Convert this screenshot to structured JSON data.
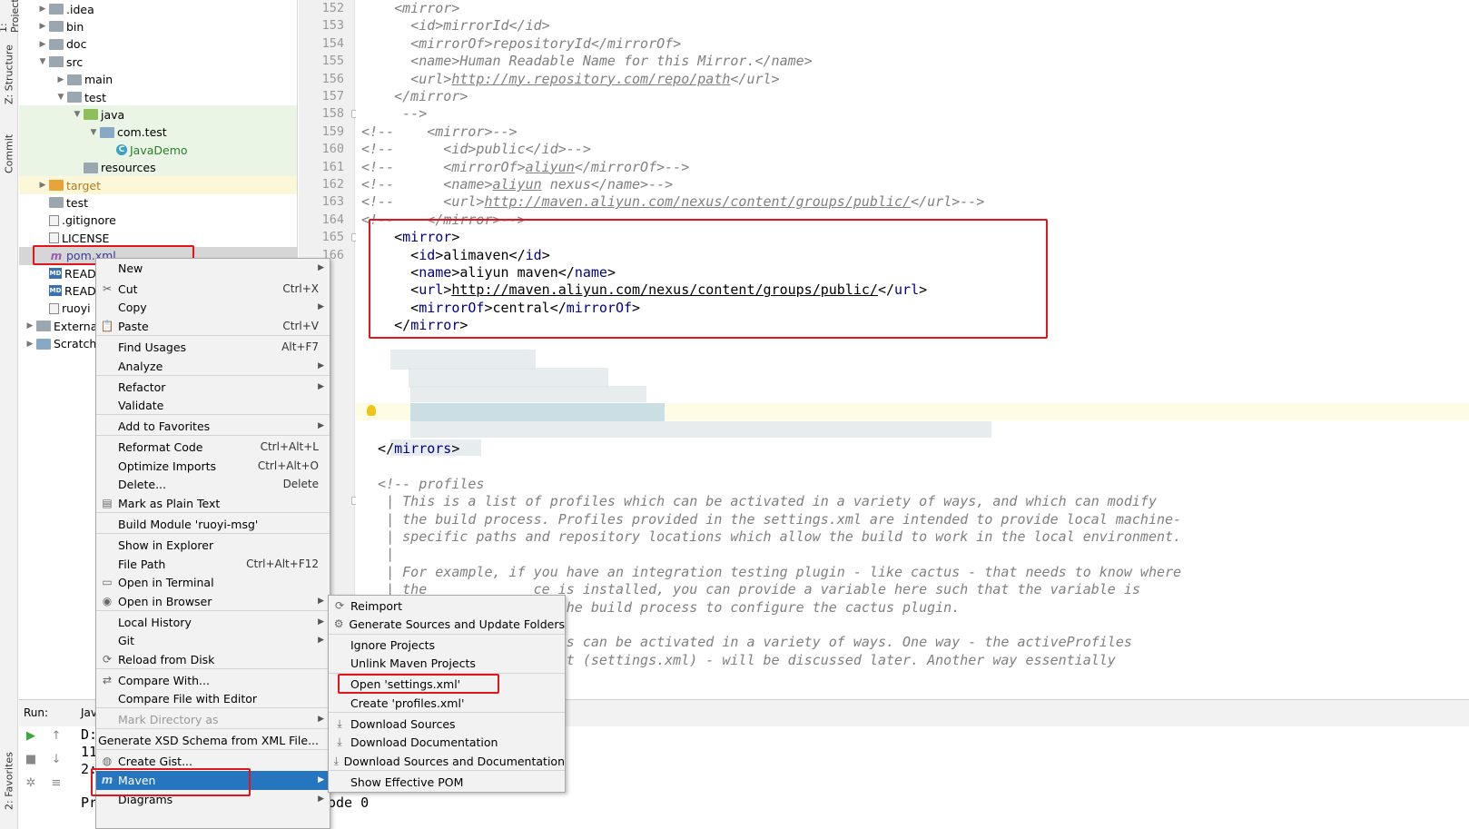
{
  "stripe": {
    "tabs": [
      {
        "label": "1: Project"
      },
      {
        "label": "Z: Structure"
      },
      {
        "label": "Commit"
      },
      {
        "label": "2: Favorites"
      }
    ]
  },
  "tree": {
    "items": [
      {
        "label": ".idea",
        "type": "folder"
      },
      {
        "label": "bin",
        "type": "folder"
      },
      {
        "label": "doc",
        "type": "folder"
      },
      {
        "label": "src",
        "type": "folder"
      },
      {
        "label": "main",
        "type": "folder"
      },
      {
        "label": "test",
        "type": "folder"
      },
      {
        "label": "java",
        "type": "folder-green"
      },
      {
        "label": "com.test",
        "type": "package"
      },
      {
        "label": "JavaDemo",
        "type": "class"
      },
      {
        "label": "resources",
        "type": "resources"
      },
      {
        "label": "target",
        "type": "folder-orange"
      },
      {
        "label": "test",
        "type": "folder"
      },
      {
        "label": ".gitignore",
        "type": "file"
      },
      {
        "label": "LICENSE",
        "type": "file"
      },
      {
        "label": "pom.xml",
        "type": "maven"
      },
      {
        "label": "READ",
        "type": "md"
      },
      {
        "label": "READ",
        "type": "md"
      },
      {
        "label": "ruoyi",
        "type": "file"
      },
      {
        "label": "External",
        "type": "lib"
      },
      {
        "label": "Scratche",
        "type": "scratch"
      }
    ]
  },
  "editor": {
    "line_numbers": [
      "152",
      "153",
      "154",
      "155",
      "156",
      "157",
      "158",
      "159",
      "160",
      "161",
      "162",
      "163",
      "164",
      "165",
      "166"
    ],
    "lines": [
      {
        "parts": [
          {
            "t": "    <mirror>",
            "c": "cm"
          }
        ]
      },
      {
        "parts": [
          {
            "t": "      <id>mirrorId</id>",
            "c": "cm"
          }
        ]
      },
      {
        "parts": [
          {
            "t": "      <mirrorOf>repositoryId</mirrorOf>",
            "c": "cm"
          }
        ]
      },
      {
        "parts": [
          {
            "t": "      <name>Human Readable Name for this Mirror.</name>",
            "c": "cm"
          }
        ]
      },
      {
        "parts": [
          {
            "t": "      <url>",
            "c": "cm"
          },
          {
            "t": "http://my.repository.com/repo/path",
            "c": "cm url"
          },
          {
            "t": "</url>",
            "c": "cm"
          }
        ]
      },
      {
        "parts": [
          {
            "t": "    </mirror>",
            "c": "cm"
          }
        ]
      },
      {
        "parts": [
          {
            "t": "     -->",
            "c": "cm"
          }
        ]
      },
      {
        "parts": [
          {
            "t": "<!--    <mirror>-->",
            "c": "cm"
          }
        ]
      },
      {
        "parts": [
          {
            "t": "<!--      <id>public</id>-->",
            "c": "cm"
          }
        ]
      },
      {
        "parts": [
          {
            "t": "<!--      <mirrorOf>",
            "c": "cm"
          },
          {
            "t": "aliyun",
            "c": "cm url"
          },
          {
            "t": "</mirrorOf>-->",
            "c": "cm"
          }
        ]
      },
      {
        "parts": [
          {
            "t": "<!--      <name>",
            "c": "cm"
          },
          {
            "t": "aliyun",
            "c": "cm url"
          },
          {
            "t": " nexus</name>-->",
            "c": "cm"
          }
        ]
      },
      {
        "parts": [
          {
            "t": "<!--      <url>",
            "c": "cm"
          },
          {
            "t": "http://maven.aliyun.com/nexus/content/groups/public/",
            "c": "cm url"
          },
          {
            "t": "</url>-->",
            "c": "cm"
          }
        ]
      },
      {
        "parts": [
          {
            "t": "<!--    </mirror>-->",
            "c": "cm"
          }
        ]
      },
      {
        "parts": [
          {
            "t": "    <",
            "c": "at"
          },
          {
            "t": "mirror",
            "c": "tg"
          },
          {
            "t": ">",
            "c": "at"
          }
        ]
      },
      {
        "parts": [
          {
            "t": "      <",
            "c": "at"
          },
          {
            "t": "id",
            "c": "tg"
          },
          {
            "t": ">alimaven</",
            "c": "at"
          },
          {
            "t": "id",
            "c": "tg"
          },
          {
            "t": ">",
            "c": "at"
          }
        ]
      },
      {
        "parts": [
          {
            "t": "      <",
            "c": "at"
          },
          {
            "t": "name",
            "c": "tg"
          },
          {
            "t": ">aliyun maven</",
            "c": "at"
          },
          {
            "t": "name",
            "c": "tg"
          },
          {
            "t": ">",
            "c": "at"
          }
        ]
      },
      {
        "parts": [
          {
            "t": "      <",
            "c": "at"
          },
          {
            "t": "url",
            "c": "tg"
          },
          {
            "t": ">",
            "c": "at"
          },
          {
            "t": "http://maven.aliyun.com/nexus/content/groups/public/",
            "c": "at url"
          },
          {
            "t": "</",
            "c": "at"
          },
          {
            "t": "url",
            "c": "tg"
          },
          {
            "t": ">",
            "c": "at"
          }
        ]
      },
      {
        "parts": [
          {
            "t": "      <",
            "c": "at"
          },
          {
            "t": "mirrorOf",
            "c": "tg"
          },
          {
            "t": ">central</",
            "c": "at"
          },
          {
            "t": "mirrorOf",
            "c": "tg"
          },
          {
            "t": ">",
            "c": "at"
          }
        ]
      },
      {
        "parts": [
          {
            "t": "    </",
            "c": "at"
          },
          {
            "t": "mirror",
            "c": "tg"
          },
          {
            "t": ">",
            "c": "at"
          }
        ]
      },
      {
        "parts": []
      },
      {
        "parts": []
      },
      {
        "parts": []
      },
      {
        "parts": []
      },
      {
        "parts": []
      },
      {
        "parts": []
      },
      {
        "parts": [
          {
            "t": "  </",
            "c": "at"
          },
          {
            "t": "mirrors",
            "c": "tg"
          },
          {
            "t": ">",
            "c": "at"
          }
        ]
      },
      {
        "parts": []
      },
      {
        "parts": [
          {
            "t": "  <!-- profiles",
            "c": "cm"
          }
        ]
      },
      {
        "parts": [
          {
            "t": "   | This is a list of profiles which can be activated in a variety of ways, and which can modify",
            "c": "cm"
          }
        ]
      },
      {
        "parts": [
          {
            "t": "   | the build process. Profiles provided in the settings.xml are intended to provide local machine-",
            "c": "cm"
          }
        ]
      },
      {
        "parts": [
          {
            "t": "   | specific paths and repository locations which allow the build to work in the local environment.",
            "c": "cm"
          }
        ]
      },
      {
        "parts": [
          {
            "t": "   |",
            "c": "cm"
          }
        ]
      },
      {
        "parts": [
          {
            "t": "   | For example, if you have an integration testing plugin - like cactus - that needs to know where",
            "c": "cm"
          }
        ]
      },
      {
        "parts": [
          {
            "t": "   | the             ce is installed, you can provide a variable here such that the variable is",
            "c": "cm"
          }
        ]
      },
      {
        "parts": [
          {
            "t": "   | derefe           g the build process to configure the cactus plugin.",
            "c": "cm"
          }
        ]
      },
      {
        "parts": [
          {
            "t": "   |",
            "c": "cm"
          }
        ]
      },
      {
        "parts": [
          {
            "t": "   | As noted       ofiles can be activated in a variety of ways. One way - the activeProfiles",
            "c": "cm"
          }
        ]
      },
      {
        "parts": [
          {
            "t": "   | section of     cument (settings.xml) - will be discussed later. Another way essentially",
            "c": "cm"
          }
        ]
      }
    ]
  },
  "runbar": {
    "label": "Run:",
    "tab": "Jav"
  },
  "console": {
    "lines": [
      "D:",
      "11",
      "2:"
    ],
    "bottom_text": "Pr",
    "bottom_text2": "ode 0"
  },
  "context_menu": {
    "items": [
      {
        "label": "New",
        "shortcut": "",
        "sub": true
      },
      {
        "label": "Cut",
        "shortcut": "Ctrl+X",
        "icon": "cut-icon"
      },
      {
        "label": "Copy",
        "shortcut": "",
        "sub": true
      },
      {
        "label": "Paste",
        "shortcut": "Ctrl+V",
        "icon": "paste-icon"
      },
      {
        "label": "Find Usages",
        "shortcut": "Alt+F7"
      },
      {
        "label": "Analyze",
        "shortcut": "",
        "sub": true
      },
      {
        "label": "Refactor",
        "shortcut": "",
        "sub": true
      },
      {
        "label": "Validate",
        "shortcut": ""
      },
      {
        "label": "Add to Favorites",
        "shortcut": "",
        "sub": true
      },
      {
        "label": "Reformat Code",
        "shortcut": "Ctrl+Alt+L"
      },
      {
        "label": "Optimize Imports",
        "shortcut": "Ctrl+Alt+O"
      },
      {
        "label": "Delete...",
        "shortcut": "Delete"
      },
      {
        "label": "Mark as Plain Text",
        "shortcut": "",
        "icon": "plain-text-icon"
      },
      {
        "label": "Build Module 'ruoyi-msg'",
        "shortcut": ""
      },
      {
        "label": "Show in Explorer",
        "shortcut": ""
      },
      {
        "label": "File Path",
        "shortcut": "Ctrl+Alt+F12"
      },
      {
        "label": "Open in Terminal",
        "shortcut": "",
        "icon": "terminal-icon"
      },
      {
        "label": "Open in Browser",
        "shortcut": "",
        "sub": true,
        "icon": "browser-icon"
      },
      {
        "label": "Local History",
        "shortcut": "",
        "sub": true
      },
      {
        "label": "Git",
        "shortcut": "",
        "sub": true
      },
      {
        "label": "Reload from Disk",
        "shortcut": "",
        "icon": "reload-icon"
      },
      {
        "label": "Compare With...",
        "shortcut": "",
        "icon": "compare-icon"
      },
      {
        "label": "Compare File with Editor",
        "shortcut": ""
      },
      {
        "label": "Mark Directory as",
        "shortcut": "",
        "sub": true,
        "disabled": true
      },
      {
        "label": "Generate XSD Schema from XML File...",
        "shortcut": ""
      },
      {
        "label": "Create Gist...",
        "shortcut": "",
        "icon": "github-icon"
      },
      {
        "label": "Maven",
        "shortcut": "",
        "sub": true,
        "active": true,
        "icon": "maven-icon"
      },
      {
        "label": "Diagrams",
        "shortcut": "",
        "sub": true
      }
    ]
  },
  "maven_menu": {
    "items": [
      {
        "label": "Reimport",
        "icon": "reimport-icon"
      },
      {
        "label": "Generate Sources and Update Folders",
        "icon": "generate-icon"
      },
      {
        "label": "Ignore Projects"
      },
      {
        "label": "Unlink Maven Projects"
      },
      {
        "label": "Open 'settings.xml'"
      },
      {
        "label": "Create 'profiles.xml'"
      },
      {
        "label": "Download Sources",
        "icon": "download-icon"
      },
      {
        "label": "Download Documentation",
        "icon": "download-icon"
      },
      {
        "label": "Download Sources and Documentation",
        "icon": "download-icon"
      },
      {
        "label": "Show Effective POM"
      }
    ]
  },
  "colors": {
    "highlight": "#e0161c",
    "menu_active": "#2675bf",
    "tag": "#000080",
    "comment": "#808080"
  }
}
